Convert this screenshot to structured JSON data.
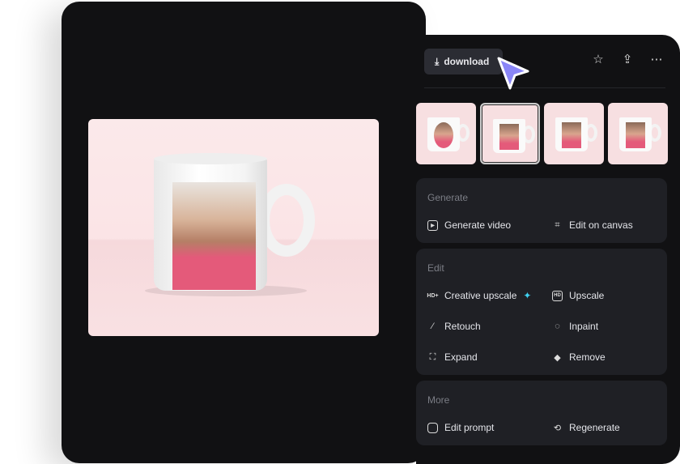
{
  "toolbar": {
    "download_label": "download"
  },
  "sections": [
    {
      "title": "Generate",
      "items": [
        "Generate video",
        "Edit on canvas"
      ]
    },
    {
      "title": "Edit",
      "items": [
        "Creative upscale",
        "Upscale",
        "Retouch",
        "Inpaint",
        "Expand",
        "Remove"
      ]
    },
    {
      "title": "More",
      "items": [
        "Edit prompt",
        "Regenerate"
      ]
    }
  ],
  "colors": {
    "accent_sparkle": "#3fd0f0",
    "cursor": "#8a86f7"
  }
}
